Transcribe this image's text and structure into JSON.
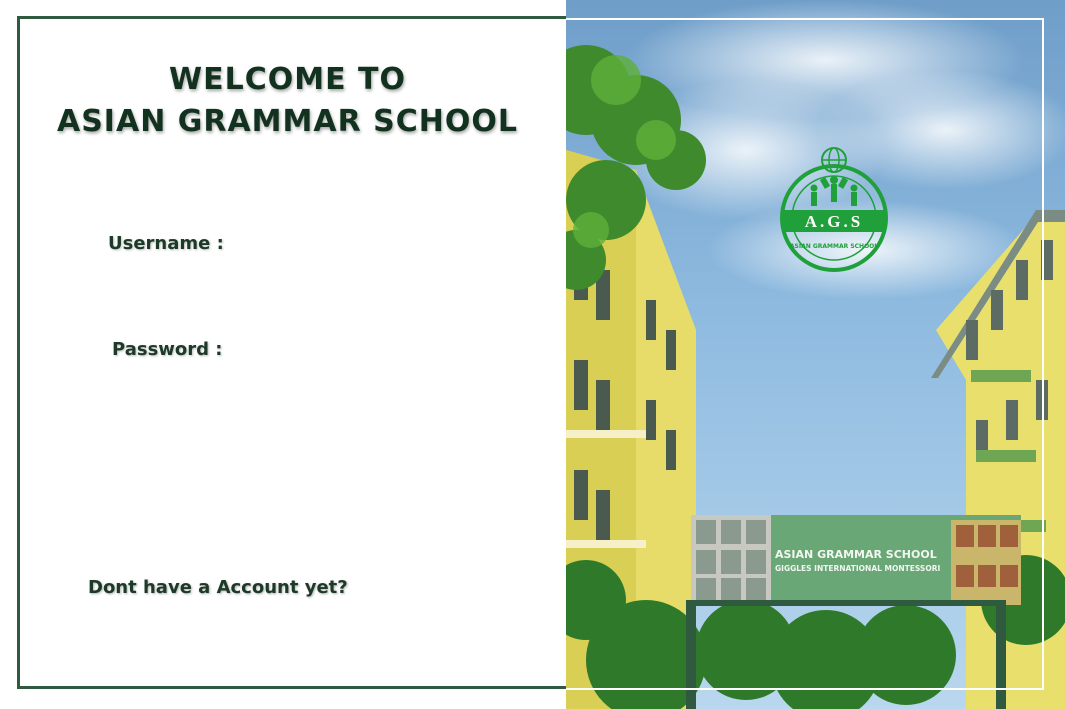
{
  "login": {
    "title_line1": "WELCOME TO",
    "title_line2": "ASIAN GRAMMAR SCHOOL",
    "username_label": "Username :",
    "password_label": "Password :",
    "signup_text": "Dont have a Account yet?"
  },
  "campus_photo": {
    "logo_text": "A.G.S",
    "logo_subtext": "ASIAN GRAMMAR SCHOOL",
    "banner_line1": "ASIAN GRAMMAR SCHOOL",
    "banner_line2": "GIGGLES INTERNATIONAL MONTESSORI"
  },
  "colors": {
    "heading": "#12321f",
    "panel_border": "#2f5a40",
    "logo_green": "#1fa03a"
  }
}
